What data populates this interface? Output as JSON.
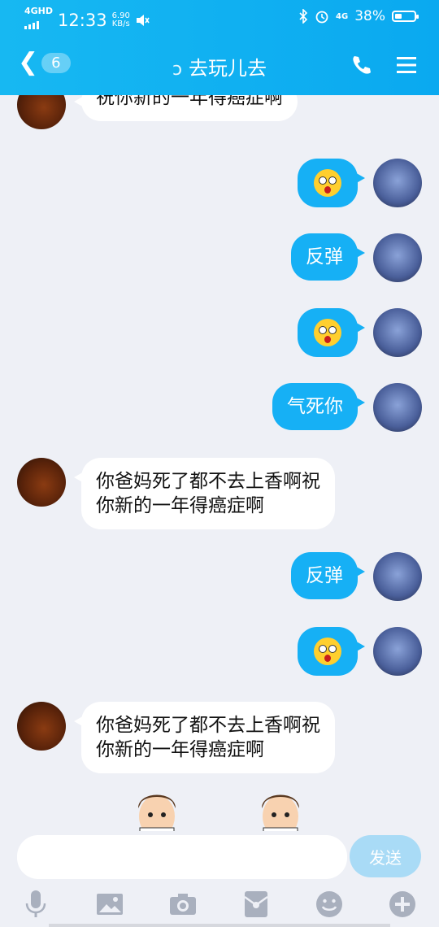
{
  "status_bar": {
    "network": "4GHD",
    "time": "12:33",
    "speed_value": "6.90",
    "speed_unit": "KB/s",
    "lte": "4G",
    "battery": "38%",
    "battery_level": 0.38
  },
  "header": {
    "unread_count": "6",
    "title": "去玩儿去"
  },
  "messages": [
    {
      "side": "left",
      "type": "text",
      "text": "祝你新的一年得癌症啊"
    },
    {
      "side": "right",
      "type": "emoji",
      "icon": "surprised-face-emoji"
    },
    {
      "side": "right",
      "type": "text",
      "text": "反弹"
    },
    {
      "side": "right",
      "type": "emoji",
      "icon": "surprised-face-emoji"
    },
    {
      "side": "right",
      "type": "text",
      "text": "气死你"
    },
    {
      "side": "left",
      "type": "text",
      "line1": "你爸妈死了都不去上香啊祝",
      "line2": "你新的一年得癌症啊"
    },
    {
      "side": "right",
      "type": "text",
      "text": "反弹"
    },
    {
      "side": "right",
      "type": "emoji",
      "icon": "surprised-face-emoji"
    },
    {
      "side": "left",
      "type": "text",
      "line1": "你爸妈死了都不去上香啊祝",
      "line2": "你新的一年得癌症啊"
    }
  ],
  "input": {
    "placeholder": "",
    "send_label": "发送"
  },
  "toolbar": [
    "mic-icon",
    "image-icon",
    "camera-icon",
    "red-packet-icon",
    "emoji-icon",
    "plus-icon"
  ],
  "colors": {
    "header": "#0fb2f2",
    "bubble_right": "#16b0f5",
    "bubble_left": "#ffffff",
    "background": "#eef0f6",
    "send_button": "#a9dbf6"
  }
}
